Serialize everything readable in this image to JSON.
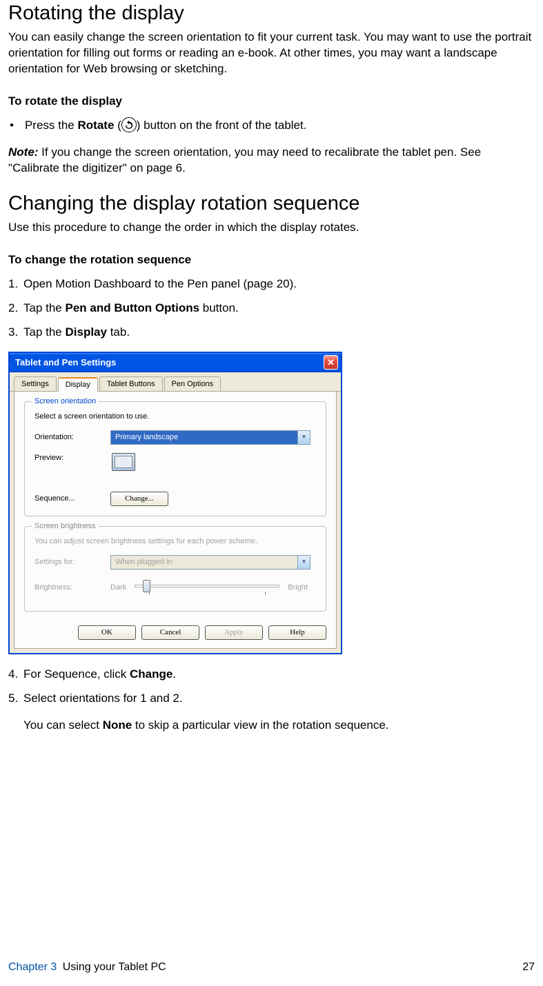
{
  "heading1": "Rotating the display",
  "intro1": "You can easily change the screen orientation to fit your current task. You may want to use the portrait orientation for filling out forms or reading an e-book. At other times, you may want a landscape orientation for Web browsing or sketching.",
  "sub1": "To rotate the display",
  "bullet1_a": "Press the ",
  "bullet1_bold": "Rotate",
  "bullet1_b": " (",
  "bullet1_c": ") button on the front of the tablet.",
  "note_label": "Note:",
  "note_text": " If you change the screen orientation, you may need to recalibrate the tablet pen. See \"Calibrate the digitizer\" on page 6.",
  "heading2": "Changing the display rotation sequence",
  "intro2": "Use this procedure to change the order in which the display rotates.",
  "sub2": "To change the rotation sequence",
  "steps": [
    {
      "text_a": "Open Motion Dashboard to the Pen panel (page 20)."
    },
    {
      "text_a": "Tap the ",
      "bold": "Pen and Button Options",
      "text_b": " button."
    },
    {
      "text_a": "Tap the ",
      "bold": "Display",
      "text_b": " tab."
    }
  ],
  "dialog": {
    "title": "Tablet and Pen Settings",
    "tabs": [
      "Settings",
      "Display",
      "Tablet Buttons",
      "Pen Options"
    ],
    "group1": {
      "title": "Screen orientation",
      "desc": "Select a screen orientation to use.",
      "orientation_label": "Orientation:",
      "orientation_value": "Primary landscape",
      "preview_label": "Preview:",
      "sequence_label": "Sequence...",
      "change_btn": "Change..."
    },
    "group2": {
      "title": "Screen brightness",
      "desc": "You can adjust screen brightness settings for each power scheme.",
      "settings_for_label": "Settings for:",
      "settings_for_value": "When plugged in",
      "brightness_label": "Brightness:",
      "dark": "Dark",
      "bright": "Bright"
    },
    "buttons": {
      "ok": "OK",
      "cancel": "Cancel",
      "apply": "Apply",
      "help": "Help"
    }
  },
  "steps2": [
    {
      "text_a": "For Sequence, click ",
      "bold": "Change",
      "text_b": "."
    },
    {
      "text_a": "Select orientations for 1 and 2."
    }
  ],
  "after_steps_a": "You can select ",
  "after_steps_bold": "None",
  "after_steps_b": " to skip a particular view in the rotation sequence.",
  "footer": {
    "chapter": "Chapter 3",
    "title": "Using your Tablet PC",
    "page": "27"
  }
}
